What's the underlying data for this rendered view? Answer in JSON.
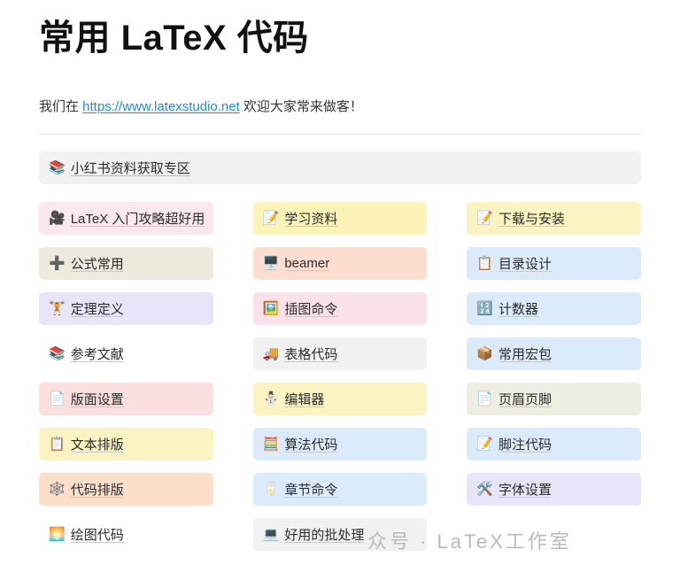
{
  "header": {
    "title": "常用 LaTeX 代码",
    "intro_prefix": "我们在 ",
    "intro_link": "https://www.latexstudio.net",
    "intro_suffix": " 欢迎大家常来做客！"
  },
  "banner": {
    "icon": "books-icon",
    "icon_glyph": "📚",
    "label": "小红书资料获取专区",
    "bg": "#f1f1f1"
  },
  "cards": [
    {
      "icon_glyph": "🎥",
      "icon_name": "movie-camera-icon",
      "label": "LaTeX 入门攻略超好用",
      "bg": "#fbe8ef"
    },
    {
      "icon_glyph": "📝",
      "icon_name": "memo-icon",
      "label": "学习资料",
      "bg": "#fcf3b8"
    },
    {
      "icon_glyph": "📝",
      "icon_name": "memo-icon",
      "label": "下载与安装",
      "bg": "#fcf3c2"
    },
    {
      "icon_glyph": "➕",
      "icon_name": "plus-icon",
      "label": "公式常用",
      "bg": "#eeeade"
    },
    {
      "icon_glyph": "🖥️",
      "icon_name": "desktop-computer-icon",
      "label": "beamer",
      "bg": "#fbded0"
    },
    {
      "icon_glyph": "📋",
      "icon_name": "clipboard-icon",
      "label": "目录设计",
      "bg": "#dcebfb"
    },
    {
      "icon_glyph": "🏋️",
      "icon_name": "weightlifter-icon",
      "label": "定理定义",
      "bg": "#e7e5f7"
    },
    {
      "icon_glyph": "🖼️",
      "icon_name": "framed-picture-icon",
      "label": "插图命令",
      "bg": "#fbe1ea"
    },
    {
      "icon_glyph": "🔢",
      "icon_name": "numbers-icon",
      "label": "计数器",
      "bg": "#dcebfb"
    },
    {
      "icon_glyph": "📚",
      "icon_name": "books-icon",
      "label": "参考文献",
      "bg": "#ffffff"
    },
    {
      "icon_glyph": "🚚",
      "icon_name": "truck-icon",
      "label": "表格代码",
      "bg": "#f1f1f1"
    },
    {
      "icon_glyph": "📦",
      "icon_name": "package-icon",
      "label": "常用宏包",
      "bg": "#dcebfb"
    },
    {
      "icon_glyph": "📄",
      "icon_name": "page-icon",
      "label": "版面设置",
      "bg": "#fbdfdf"
    },
    {
      "icon_glyph": "⛄",
      "icon_name": "snowman-icon",
      "label": "编辑器",
      "bg": "#fcf3c2"
    },
    {
      "icon_glyph": "📄",
      "icon_name": "page-icon",
      "label": "页眉页脚",
      "bg": "#efece1"
    },
    {
      "icon_glyph": "📋",
      "icon_name": "clipboard-icon",
      "label": "文本排版",
      "bg": "#fcf3c2"
    },
    {
      "icon_glyph": "🧮",
      "icon_name": "abacus-icon",
      "label": "算法代码",
      "bg": "#dcebfb"
    },
    {
      "icon_glyph": "📝",
      "icon_name": "memo-icon",
      "label": "脚注代码",
      "bg": "#dcebfb"
    },
    {
      "icon_glyph": "🕸️",
      "icon_name": "spider-web-icon",
      "label": "代码排版",
      "bg": "#fbdfcb"
    },
    {
      "icon_glyph": "🥛",
      "icon_name": "glass-of-milk-icon",
      "label": "章节命令",
      "bg": "#dcebfb"
    },
    {
      "icon_glyph": "🛠️",
      "icon_name": "hammer-and-wrench-icon",
      "label": "字体设置",
      "bg": "#e7e5f7"
    },
    {
      "icon_glyph": "🌅",
      "icon_name": "sunrise-icon",
      "label": "绘图代码",
      "bg": "#ffffff"
    },
    {
      "icon_glyph": "💻",
      "icon_name": "laptop-icon",
      "label": "好用的批处理",
      "bg": "#f1f1f1"
    }
  ],
  "watermark": {
    "text": "众号 · LaTeX工作室"
  },
  "colors": {
    "link": "#1d8ae8",
    "divider": "#e2e2e2",
    "label": "#2b2b2b"
  }
}
